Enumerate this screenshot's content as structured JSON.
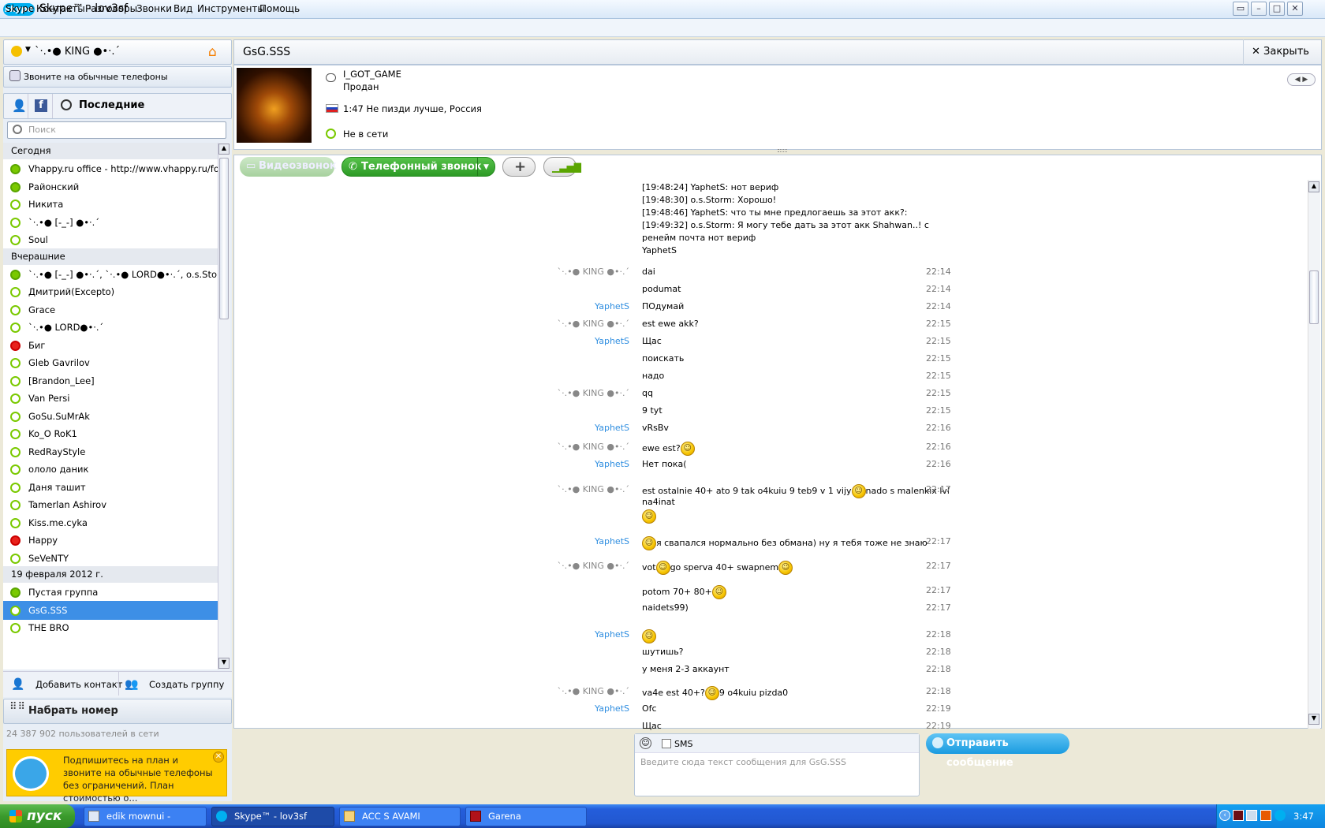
{
  "window": {
    "title": "Skype™ - lov3sf",
    "logo": "skype"
  },
  "menu": [
    "Skype",
    "Контакты",
    "Разговоры",
    "Звонки",
    "Вид",
    "Инструменты",
    "Помощь"
  ],
  "profile": {
    "name": "`·.•● KING ●•·.´"
  },
  "call_phones": "Звоните на обычные телефоны",
  "tabs": {
    "recent": "Последние"
  },
  "search": {
    "placeholder": "Поиск"
  },
  "contact_groups": [
    {
      "label": "Сегодня",
      "contacts": [
        {
          "name": "Vhappy.ru office - http://www.vhappy.ru/for...",
          "status": "group"
        },
        {
          "name": "Районский",
          "status": "online"
        },
        {
          "name": "Никита",
          "status": "offline"
        },
        {
          "name": "`·.•● [-_-] ●•·.´",
          "status": "offline"
        },
        {
          "name": "Soul",
          "status": "offline"
        }
      ]
    },
    {
      "label": "Вчерашние",
      "contacts": [
        {
          "name": "`·.•● [-_-] ●•·.´, `·.•● LORD●•·.´, o.s.Storm",
          "status": "group"
        },
        {
          "name": "Дмитрий(Excepto)",
          "status": "offline"
        },
        {
          "name": "Grace",
          "status": "offline"
        },
        {
          "name": "`·.•● LORD●•·.´",
          "status": "offline"
        },
        {
          "name": "Биг",
          "status": "dnd"
        },
        {
          "name": "Gleb Gavrilov",
          "status": "offline"
        },
        {
          "name": "[Brandon_Lee]",
          "status": "offline"
        },
        {
          "name": "Van Persi",
          "status": "offline"
        },
        {
          "name": "GoSu.SuMrAk",
          "status": "offline"
        },
        {
          "name": "Ko_O RoK1",
          "status": "offline"
        },
        {
          "name": "RedRayStyle",
          "status": "offline"
        },
        {
          "name": "ололо даник",
          "status": "offline"
        },
        {
          "name": "Даня ташит",
          "status": "offline"
        },
        {
          "name": "Tamerlan Ashirov",
          "status": "offline"
        },
        {
          "name": "Kiss.me.cyka",
          "status": "offline"
        },
        {
          "name": "Happy",
          "status": "dnd"
        },
        {
          "name": "SeVeNTY",
          "status": "offline"
        }
      ]
    },
    {
      "label": "19 февраля 2012 г.",
      "contacts": [
        {
          "name": "Пустая группа",
          "status": "group"
        },
        {
          "name": "GsG.SSS",
          "status": "offline",
          "selected": true
        },
        {
          "name": "THE BRO",
          "status": "offline"
        }
      ]
    }
  ],
  "actions": {
    "add_contact": "Добавить контакт",
    "create_group": "Создать группу",
    "dial": "Набрать номер"
  },
  "online_count": "24 387 902 пользователей в сети",
  "promo": {
    "text": "Подпишитесь на план и звоните на обычные телефоны без ограничений. План стоимостью о..."
  },
  "chat": {
    "title": "GsG.SSS",
    "close": "Закрыть",
    "mood": "I_GOT_GAME",
    "mood2": "Продан",
    "location": "1:47 Не пизди лучше, Россия",
    "status": "Не в сети",
    "video_call": "Видеозвонок",
    "phone_call": "Телефонный звонок",
    "quoted": [
      "[19:48:24] YaphetS: нот вериф",
      "[19:48:30] o.s.Storm: Хорошо!",
      "[19:48:46] YaphetS: что ты мне предлогаешь за этот акк?:",
      "[19:49:32] o.s.Storm: Я могу тебе дать за этот акк Shahwan..! с",
      "ренейм почта нот вериф",
      "YaphetS"
    ],
    "messages": [
      {
        "sender": "`·.•● KING ●•·.´",
        "text": "dai",
        "time": "22:14"
      },
      {
        "sender": "",
        "text": "podumat",
        "time": "22:14"
      },
      {
        "sender": "YaphetS",
        "text": "ПОдумай",
        "time": "22:14"
      },
      {
        "sender": "`·.•● KING ●•·.´",
        "text": "est ewe akk?",
        "time": "22:15"
      },
      {
        "sender": "YaphetS",
        "text": "Щас",
        "time": "22:15"
      },
      {
        "sender": "",
        "text": "поискать",
        "time": "22:15"
      },
      {
        "sender": "",
        "text": "надо",
        "time": "22:15"
      },
      {
        "sender": "`·.•● KING ●•·.´",
        "text": "qq",
        "time": "22:15"
      },
      {
        "sender": "",
        "text": "9 tyt",
        "time": "22:15"
      },
      {
        "sender": "YaphetS",
        "text": "vRsBv",
        "time": "22:16"
      },
      {
        "sender": "`·.•● KING ●•·.´",
        "text": "ewe est?",
        "time": "22:16"
      },
      {
        "sender": "YaphetS",
        "text": "Нет пока(",
        "time": "22:16"
      },
      {
        "sender": "`·.•● KING ●•·.´",
        "text": "est ostalnie 40+ ato 9 tak o4kuiu 9 teb9 v 1 vijy",
        "text2": "nado s malenkix lvl",
        "text3": "na4inat",
        "time": "22:17"
      },
      {
        "sender": "YaphetS",
        "text": "я свапался нормально без обмана) ну я тебя тоже не знаю",
        "time": "22:17"
      },
      {
        "sender": "`·.•● KING ●•·.´",
        "text": "vot",
        "text2": "go sperva 40+ swapnem",
        "time": "22:17"
      },
      {
        "sender": "",
        "text": "potom 70+ 80+",
        "time": "22:17"
      },
      {
        "sender": "",
        "text": "naidets99)",
        "time": "22:17"
      },
      {
        "sender": "YaphetS",
        "text": "",
        "time": "22:18"
      },
      {
        "sender": "",
        "text": "шутишь?",
        "time": "22:18"
      },
      {
        "sender": "",
        "text": "у меня 2-3 аккаунт",
        "time": "22:18"
      },
      {
        "sender": "`·.•● KING ●•·.´",
        "text": "va4e est 40+?",
        "text2": "9 o4kuiu pizda0",
        "time": "22:18"
      },
      {
        "sender": "YaphetS",
        "text": "Ofc",
        "time": "22:19"
      },
      {
        "sender": "",
        "text": "Щас",
        "time": "22:19"
      }
    ],
    "sms_label": "SMS",
    "composer_placeholder": "Введите сюда текст сообщения для GsG.SSS",
    "send": "Отправить сообщение"
  },
  "taskbar": {
    "start": "пуск",
    "tasks": [
      "edik mownui - Блокнот",
      "Skype™ - lov3sf",
      "ACC S AVAMI",
      "Garena"
    ],
    "clock": "3:47"
  },
  "colors": {
    "skype_blue": "#00aff0",
    "online_green": "#7ac900",
    "selected": "#3d8fe6",
    "sender_blue": "#2f8ee0",
    "call_green": "#3aa83a"
  }
}
